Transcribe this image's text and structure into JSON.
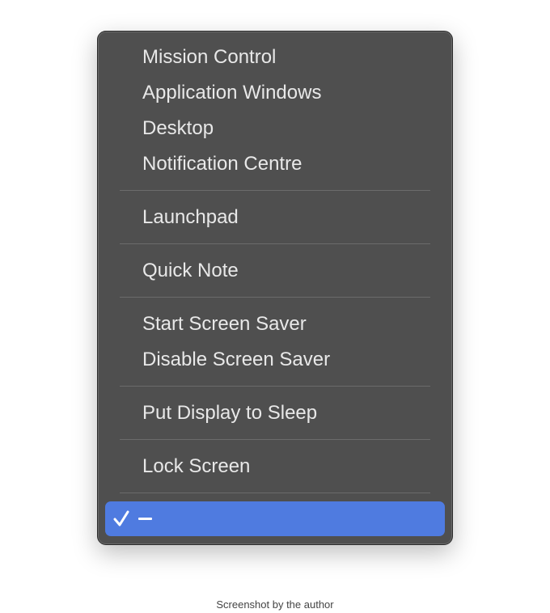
{
  "menu": {
    "groups": [
      [
        "Mission Control",
        "Application Windows",
        "Desktop",
        "Notification Centre"
      ],
      [
        "Launchpad"
      ],
      [
        "Quick Note"
      ],
      [
        "Start Screen Saver",
        "Disable Screen Saver"
      ],
      [
        "Put Display to Sleep"
      ],
      [
        "Lock Screen"
      ]
    ],
    "selected": {
      "label": "–",
      "checked": true,
      "icon": "checkmark-icon"
    },
    "accent": "#4f7be0"
  },
  "caption": "Screenshot by the author"
}
